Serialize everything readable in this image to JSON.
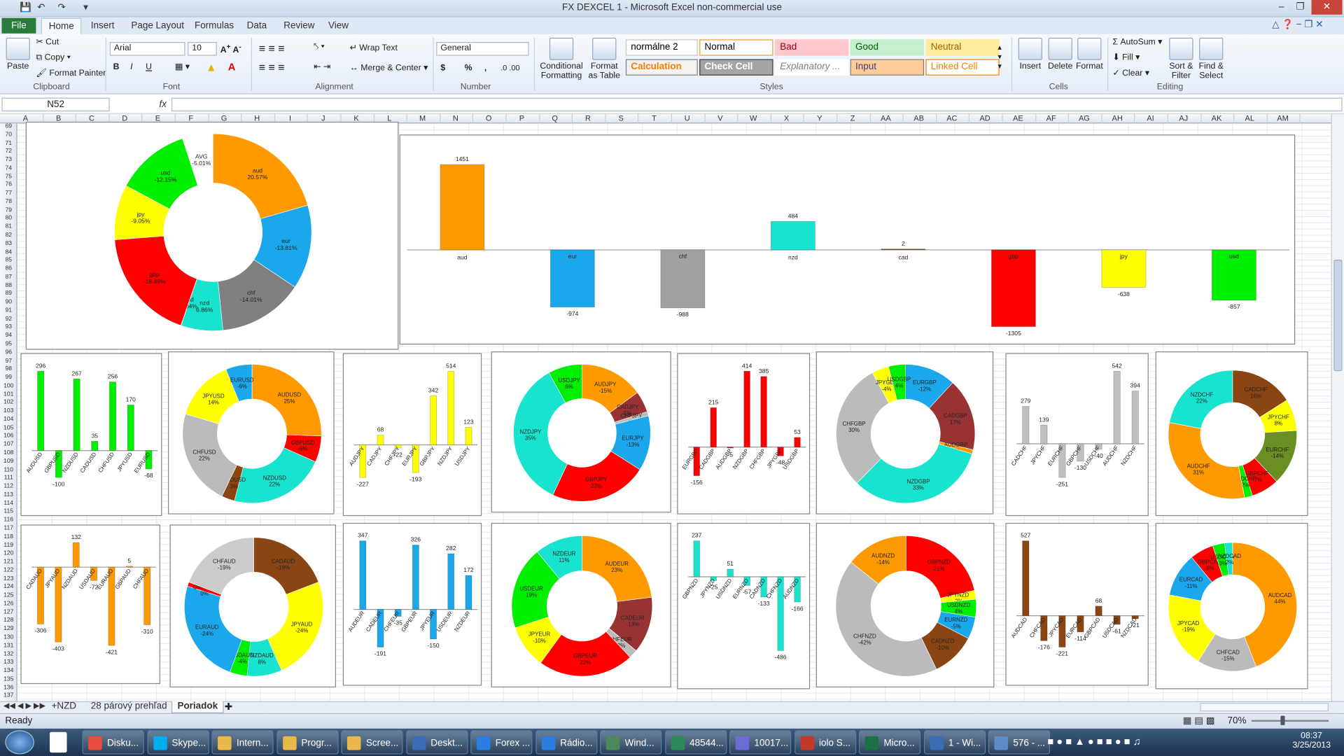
{
  "window": {
    "title": "FX DEXCEL 1  -  Microsoft Excel non-commercial use"
  },
  "ribbon_tabs": [
    "Insert",
    "Page Layout",
    "Formulas",
    "Data",
    "Review",
    "View"
  ],
  "file_tab": "File",
  "home_tab": "Home",
  "clipboard": {
    "paste": "Paste",
    "cut": "Cut",
    "copy": "Copy",
    "format_painter": "Format Painter",
    "label": "Clipboard"
  },
  "font": {
    "name": "Arial",
    "size": "10",
    "label": "Font",
    "bold": "B",
    "italic": "I",
    "underline": "U"
  },
  "alignment": {
    "wrap": "Wrap Text",
    "merge": "Merge & Center",
    "label": "Alignment"
  },
  "number": {
    "format": "General",
    "currency": "$",
    "percent": "%",
    "comma": ",",
    "label": "Number"
  },
  "styles": {
    "conditional": "Conditional Formatting",
    "format_table": "Format as Table",
    "label": "Styles",
    "cells": [
      {
        "text": "normálne 2",
        "bg": "#ffffff",
        "fg": "#000000",
        "border": "#c6c6c6"
      },
      {
        "text": "Normal",
        "bg": "#ffffff",
        "fg": "#000000",
        "border": "#e8a23c"
      },
      {
        "text": "Bad",
        "bg": "#ffc7ce",
        "fg": "#9c0006",
        "border": "#ffc7ce"
      },
      {
        "text": "Good",
        "bg": "#c6efce",
        "fg": "#006100",
        "border": "#c6efce"
      },
      {
        "text": "Neutral",
        "bg": "#ffeb9c",
        "fg": "#9c6500",
        "border": "#ffeb9c"
      },
      {
        "text": "Calculation",
        "bg": "#f2f2f2",
        "fg": "#fa7d00",
        "border": "#7f7f7f"
      },
      {
        "text": "Check Cell",
        "bg": "#a5a5a5",
        "fg": "#ffffff",
        "border": "#3f3f3f"
      },
      {
        "text": "Explanatory ...",
        "bg": "#ffffff",
        "fg": "#7f7f7f",
        "border": "#ffffff"
      },
      {
        "text": "Input",
        "bg": "#ffcc99",
        "fg": "#3f3f76",
        "border": "#7f7f7f"
      },
      {
        "text": "Linked Cell",
        "bg": "#ffffff",
        "fg": "#fa7d00",
        "border": "#ff8001"
      }
    ]
  },
  "cells_group": {
    "insert": "Insert",
    "delete": "Delete",
    "format": "Format",
    "label": "Cells"
  },
  "editing": {
    "autosum": "AutoSum",
    "fill": "Fill",
    "clear": "Clear",
    "sort": "Sort & Filter",
    "find": "Find & Select",
    "label": "Editing"
  },
  "formula_bar": {
    "name_box": "N52",
    "fx": "fx",
    "value": ""
  },
  "columns": [
    "A",
    "B",
    "C",
    "D",
    "E",
    "F",
    "G",
    "H",
    "I",
    "J",
    "K",
    "L",
    "M",
    "N",
    "O",
    "P",
    "Q",
    "R",
    "S",
    "T",
    "U",
    "V",
    "W",
    "X",
    "Y",
    "Z",
    "AA",
    "AB",
    "AC",
    "AD",
    "AE",
    "AF",
    "AG",
    "AH",
    "AI",
    "AJ",
    "AK",
    "AL",
    "AM"
  ],
  "rows_start": 69,
  "rows_count": 69,
  "sheets": [
    "+NZD",
    "28 párový prehľad",
    "Poriadok"
  ],
  "active_sheet": "Poriadok",
  "status": {
    "ready": "Ready",
    "zoom": "70%"
  },
  "taskbar": {
    "items": [
      "Disku...",
      "Skype...",
      "Intern...",
      "Progr...",
      "Scree...",
      "Deskt...",
      "Forex ...",
      "Rádio...",
      "Wind...",
      "48544...",
      "10017...",
      "iolo S...",
      "Micro...",
      "1 - Wi...",
      "576 - ..."
    ],
    "time": "08:37",
    "date": "3/25/2013"
  },
  "chart_data": [
    {
      "type": "donut",
      "slices": [
        {
          "label": "aud",
          "pct": "20.57%",
          "value": 20.57,
          "color": "#ff9900"
        },
        {
          "label": "eur",
          "pct": "-13.81%",
          "value": 13.81,
          "color": "#1aa7ec"
        },
        {
          "label": "chf",
          "pct": "-14.01%",
          "value": 14.01,
          "color": "#808080"
        },
        {
          "label": "nzd",
          "pct": "6.86%",
          "value": 6.86,
          "color": "#17e3cf"
        },
        {
          "label": "cad",
          "pct": "0.04%",
          "value": 0.04,
          "color": "#8b4513"
        },
        {
          "label": "gbp",
          "pct": "-18.49%",
          "value": 18.49,
          "color": "#ff0000"
        },
        {
          "label": "jpy",
          "pct": "-9.05%",
          "value": 9.05,
          "color": "#ffff00"
        },
        {
          "label": "usd",
          "pct": "-12.15%",
          "value": 12.15,
          "color": "#00ee00"
        },
        {
          "label": "AVG",
          "pct": "-5.01%",
          "value": 5.01,
          "color": "#ffffff"
        }
      ]
    },
    {
      "type": "bar",
      "categories": [
        "aud",
        "eur",
        "chf",
        "nzd",
        "cad",
        "gbp",
        "jpy",
        "usd"
      ],
      "values": [
        1451,
        -974,
        -988,
        484,
        2,
        -1305,
        -638,
        -857
      ],
      "colors": [
        "#ff9900",
        "#1aa7ec",
        "#a0a0a0",
        "#17e3cf",
        "#8b4513",
        "#ff0000",
        "#ffff00",
        "#00ee00"
      ]
    },
    {
      "type": "bar",
      "categories": [
        "AUDUSD",
        "GBPUSD",
        "NZDUSD",
        "CADUSD",
        "CHFUSD",
        "JPYUSD",
        "EURUSD"
      ],
      "values": [
        296,
        -100,
        267,
        35,
        256,
        170,
        -68
      ],
      "color": "#00ee00"
    },
    {
      "type": "donut",
      "slices": [
        {
          "label": "AUDUSD",
          "pct": "25%",
          "value": 25,
          "color": "#ff9900"
        },
        {
          "label": "GBPUSD",
          "pct": "-6%",
          "value": 6,
          "color": "#ff0000"
        },
        {
          "label": "NZDUSD",
          "pct": "22%",
          "value": 22,
          "color": "#17e3cf"
        },
        {
          "label": "CADUSD",
          "pct": "3%",
          "value": 3,
          "color": "#8b4513"
        },
        {
          "label": "CHFUSD",
          "pct": "22%",
          "value": 22,
          "color": "#bbbbbb"
        },
        {
          "label": "JPYUSD",
          "pct": "14%",
          "value": 14,
          "color": "#ffff00"
        },
        {
          "label": "EURUSD",
          "pct": "-6%",
          "value": 6,
          "color": "#1aa7ec"
        }
      ]
    },
    {
      "type": "bar",
      "categories": [
        "AUDJPY",
        "CADJPY",
        "CHFJPY",
        "EURJPY",
        "GBPJPY",
        "NZDJPY",
        "USDJPY"
      ],
      "values": [
        -227,
        68,
        -22,
        -193,
        342,
        514,
        123
      ],
      "color": "#ffff00"
    },
    {
      "type": "donut",
      "slices": [
        {
          "label": "AUDJPY",
          "pct": "-15%",
          "value": 15,
          "color": "#ff9900"
        },
        {
          "label": "CADJPY",
          "pct": "5%",
          "value": 5,
          "color": "#993333"
        },
        {
          "label": "CHFJPY",
          "pct": "-1%",
          "value": 1,
          "color": "#bbbbbb"
        },
        {
          "label": "EURJPY",
          "pct": "-13%",
          "value": 13,
          "color": "#1aa7ec"
        },
        {
          "label": "GBPJPY",
          "pct": "23%",
          "value": 23,
          "color": "#ff0000"
        },
        {
          "label": "NZDJPY",
          "pct": "35%",
          "value": 35,
          "color": "#17e3cf"
        },
        {
          "label": "USDJPY",
          "pct": "8%",
          "value": 8,
          "color": "#00ee00"
        }
      ]
    },
    {
      "type": "bar",
      "categories": [
        "EURGBP",
        "CADGBP",
        "AUDGBP",
        "NZDGBP",
        "CHFGBP",
        "JPYGBP",
        "USDGBP"
      ],
      "values": [
        -156,
        215,
        -5,
        414,
        385,
        -48,
        53
      ],
      "color": "#ff0000"
    },
    {
      "type": "donut",
      "slices": [
        {
          "label": "EURGBP",
          "pct": "-12%",
          "value": 12,
          "color": "#1aa7ec"
        },
        {
          "label": "CADGBP",
          "pct": "17%",
          "value": 17,
          "color": "#993333"
        },
        {
          "label": "AUDGBP",
          "pct": "0%",
          "value": 1,
          "color": "#ff9900"
        },
        {
          "label": "NZDGBP",
          "pct": "33%",
          "value": 33,
          "color": "#17e3cf"
        },
        {
          "label": "CHFGBP",
          "pct": "30%",
          "value": 30,
          "color": "#bbbbbb"
        },
        {
          "label": "JPYGBP",
          "pct": "-4%",
          "value": 4,
          "color": "#ffff00"
        },
        {
          "label": "USDGBP",
          "pct": "4%",
          "value": 4,
          "color": "#00ee00"
        }
      ]
    },
    {
      "type": "bar",
      "categories": [
        "CADCHF",
        "JPYCHF",
        "EURCHF",
        "GBPCHF",
        "USDCHF",
        "AUDCHF",
        "NZDCHF"
      ],
      "values": [
        279,
        139,
        -251,
        -130,
        -40,
        542,
        394
      ],
      "color": "#c0c0c0"
    },
    {
      "type": "donut",
      "slices": [
        {
          "label": "CADCHF",
          "pct": "16%",
          "value": 16,
          "color": "#8b4513"
        },
        {
          "label": "JPYCHF",
          "pct": "8%",
          "value": 8,
          "color": "#ffff00"
        },
        {
          "label": "EURCHF",
          "pct": "-14%",
          "value": 14,
          "color": "#6b8e23"
        },
        {
          "label": "GBPCHF",
          "pct": "-7%",
          "value": 7,
          "color": "#ff0000"
        },
        {
          "label": "USDCHF",
          "pct": "-2%",
          "value": 2,
          "color": "#00ee00"
        },
        {
          "label": "AUDCHF",
          "pct": "31%",
          "value": 31,
          "color": "#ff9900"
        },
        {
          "label": "NZDCHF",
          "pct": "22%",
          "value": 22,
          "color": "#17e3cf"
        }
      ]
    },
    {
      "type": "bar",
      "categories": [
        "CADAUD",
        "JPYAUD",
        "NZDAUD",
        "USDAUD",
        "EURAUD",
        "GBPAUD",
        "CHFAUD"
      ],
      "values": [
        -306,
        -403,
        132,
        -72,
        -421,
        5,
        -310
      ],
      "color": "#ff9900"
    },
    {
      "type": "donut",
      "slices": [
        {
          "label": "CADAUD",
          "pct": "-19%",
          "value": 19,
          "color": "#8b4513"
        },
        {
          "label": "JPYAUD",
          "pct": "-24%",
          "value": 24,
          "color": "#ffff00"
        },
        {
          "label": "NZDAUD",
          "pct": "8%",
          "value": 8,
          "color": "#17e3cf"
        },
        {
          "label": "USDAUD",
          "pct": "-4%",
          "value": 4,
          "color": "#00ee00"
        },
        {
          "label": "EURAUD",
          "pct": "-24%",
          "value": 24,
          "color": "#1aa7ec"
        },
        {
          "label": "GBPAUD",
          "pct": "0%",
          "value": 1,
          "color": "#ff0000"
        },
        {
          "label": "CHFAUD",
          "pct": "-19%",
          "value": 19,
          "color": "#cccccc"
        }
      ]
    },
    {
      "type": "bar",
      "categories": [
        "AUDEUR",
        "CADEUR",
        "CHFEUR",
        "GBPEUR",
        "JPYEUR",
        "USDEUR",
        "NZDEUR"
      ],
      "values": [
        347,
        -191,
        -35,
        326,
        -150,
        282,
        172
      ],
      "color": "#1aa7ec"
    },
    {
      "type": "donut",
      "slices": [
        {
          "label": "AUDEUR",
          "pct": "23%",
          "value": 23,
          "color": "#ff9900"
        },
        {
          "label": "CADEUR",
          "pct": "-13%",
          "value": 13,
          "color": "#993333"
        },
        {
          "label": "CHFEUR",
          "pct": "-2%",
          "value": 2,
          "color": "#bbbbbb"
        },
        {
          "label": "GBPEUR",
          "pct": "22%",
          "value": 22,
          "color": "#ff0000"
        },
        {
          "label": "JPYEUR",
          "pct": "-10%",
          "value": 10,
          "color": "#ffff00"
        },
        {
          "label": "USDEUR",
          "pct": "19%",
          "value": 19,
          "color": "#00ee00"
        },
        {
          "label": "NZDEUR",
          "pct": "11%",
          "value": 11,
          "color": "#17e3cf"
        }
      ]
    },
    {
      "type": "bar",
      "categories": [
        "GBPNZD",
        "JPYNZD",
        "USDNZD",
        "EURNZD",
        "CADNZD",
        "CHFNZD",
        "AUDNZD"
      ],
      "values": [
        237,
        -25,
        51,
        -57,
        -133,
        -486,
        -166
      ],
      "color": "#17e3cf"
    },
    {
      "type": "donut",
      "slices": [
        {
          "label": "GBPNZD",
          "pct": "21%",
          "value": 21,
          "color": "#ff0000"
        },
        {
          "label": "JPYNZD",
          "pct": "-2%",
          "value": 2,
          "color": "#ffff00"
        },
        {
          "label": "USDNZD",
          "pct": "4%",
          "value": 4,
          "color": "#00ee00"
        },
        {
          "label": "EURNZD",
          "pct": "-5%",
          "value": 5,
          "color": "#1aa7ec"
        },
        {
          "label": "CADNZD",
          "pct": "-10%",
          "value": 10,
          "color": "#8b4513"
        },
        {
          "label": "CHFNZD",
          "pct": "-42%",
          "value": 42,
          "color": "#bbbbbb"
        },
        {
          "label": "AUDNZD",
          "pct": "-14%",
          "value": 14,
          "color": "#ff9900"
        }
      ]
    },
    {
      "type": "bar",
      "categories": [
        "AUDCAD",
        "CHFCAD",
        "JPYCAD",
        "EURCAD",
        "GBPCAD",
        "USDCAD",
        "NZDCAD"
      ],
      "values": [
        527,
        -176,
        -221,
        -114,
        68,
        -61,
        -21
      ],
      "color": "#8b4513"
    },
    {
      "type": "donut",
      "slices": [
        {
          "label": "AUDCAD",
          "pct": "44%",
          "value": 44,
          "color": "#ff9900"
        },
        {
          "label": "CHFCAD",
          "pct": "-15%",
          "value": 15,
          "color": "#bbbbbb"
        },
        {
          "label": "JPYCAD",
          "pct": "-19%",
          "value": 19,
          "color": "#ffff00"
        },
        {
          "label": "EURCAD",
          "pct": "-11%",
          "value": 11,
          "color": "#1aa7ec"
        },
        {
          "label": "GBPCAD",
          "pct": "-6%",
          "value": 6,
          "color": "#ff0000"
        },
        {
          "label": "USDCAD",
          "pct": "-3%",
          "value": 3,
          "color": "#00ee00"
        },
        {
          "label": "NZDCAD",
          "pct": "2%",
          "value": 2,
          "color": "#17e3cf"
        }
      ]
    }
  ]
}
